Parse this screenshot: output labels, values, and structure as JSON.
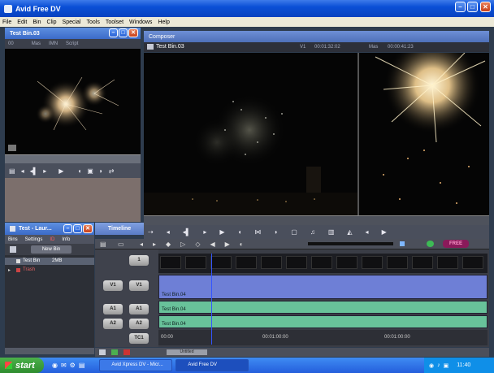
{
  "window": {
    "title": "Avid Free DV"
  },
  "menu": [
    "File",
    "Edit",
    "Bin",
    "Clip",
    "Special",
    "Tools",
    "Toolset",
    "Windows",
    "Help"
  ],
  "source_monitor": {
    "title": "Test Bin.03",
    "tc": "00",
    "tabs": [
      "Mas",
      "IMN",
      "Script"
    ]
  },
  "composer": {
    "title": "Composer",
    "clip": "Test Bin.03",
    "left_tc_label": "V1",
    "left_tc": "00:01:32:02",
    "right_tc_label": "Mas",
    "right_tc": "00:00:41:23"
  },
  "bin": {
    "title": "Test - Laur...",
    "tabs": [
      "Bins",
      "Settings",
      "ID",
      "Info"
    ],
    "new_bin": "New Bin",
    "items": [
      {
        "name": "Test Bin",
        "size": "2MB"
      },
      {
        "name": "Trash"
      }
    ]
  },
  "timeline": {
    "title": "Timeline",
    "patch_button": "1",
    "tracks": [
      {
        "source": "V1",
        "record": "V1",
        "clip": "Test Bin.04",
        "color": "#6e7fd6"
      },
      {
        "source": "A1",
        "record": "A1",
        "clip": "Test Bin.04",
        "color": "#68c29a"
      },
      {
        "source": "A2",
        "record": "A2",
        "clip": "Test Bin.04",
        "color": "#68c29a"
      }
    ],
    "tc_track": "TC1",
    "tc_start": "00:00",
    "tc_mid": "00:01:00:00",
    "tc_end": "00:01:00:00",
    "zoom": "Untitled",
    "badge": "FREE"
  },
  "taskbar": {
    "start": "start",
    "tasks": [
      "Avid Xpress DV - Micr...",
      "Avid Free DV"
    ],
    "clock": "11:40"
  },
  "colors": {
    "accent": "#0a4fd6",
    "video_track": "#6e7fd6",
    "audio_track": "#68c29a",
    "playhead": "#3355ff"
  }
}
